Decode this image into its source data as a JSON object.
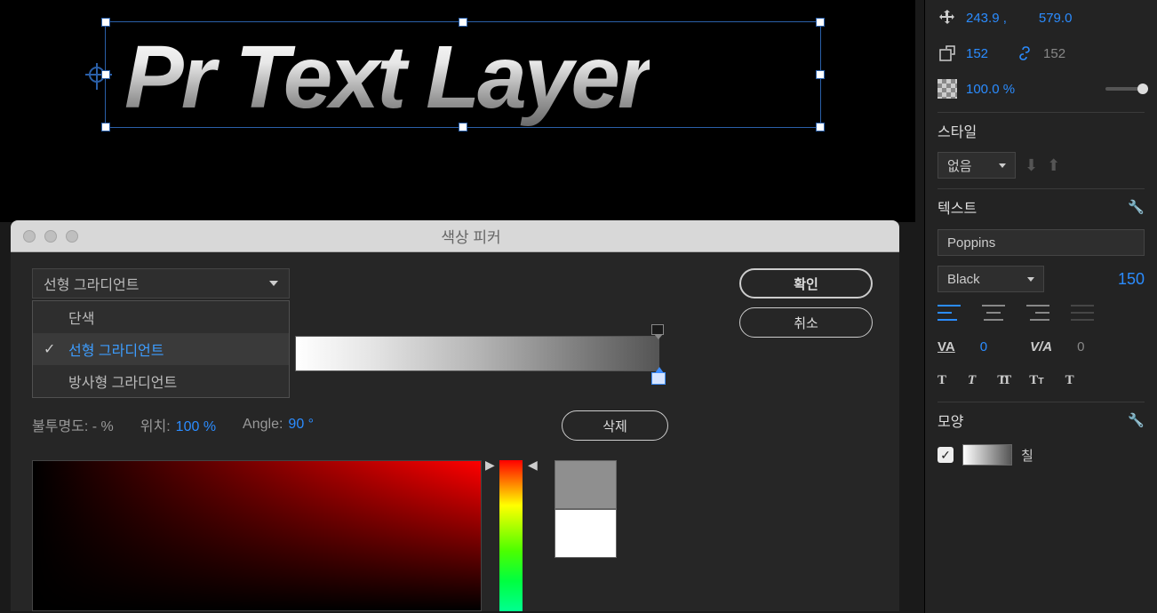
{
  "canvas": {
    "text": "Pr Text Layer"
  },
  "transform": {
    "pos_x": "243.9 ,",
    "pos_y": "579.0",
    "w": "152",
    "h": "152",
    "opacity": "100.0 %"
  },
  "style": {
    "title": "스타일",
    "dropdown": "없음"
  },
  "text": {
    "title": "텍스트",
    "font": "Poppins",
    "weight": "Black",
    "size": "150",
    "tracking": "0",
    "kerning": "0"
  },
  "shape": {
    "title": "모양",
    "fill_label": "칠"
  },
  "picker": {
    "title": "색상 피커",
    "type_selected": "선형 그라디언트",
    "options": {
      "solid": "단색",
      "linear": "선형 그라디언트",
      "radial": "방사형 그라디언트"
    },
    "opacity_label": "불투명도: - %",
    "position_label": "위치:",
    "position_val": "100 %",
    "angle_label": "Angle:",
    "angle_val": "90 °",
    "ok": "확인",
    "cancel": "취소",
    "delete": "삭제"
  }
}
